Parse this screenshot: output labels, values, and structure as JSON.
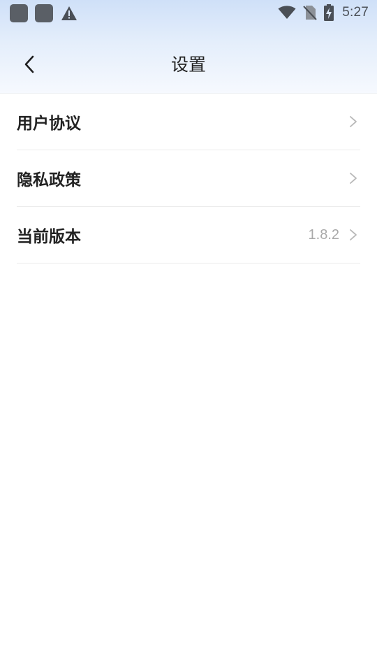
{
  "status_bar": {
    "time": "5:27",
    "icons": [
      "app-notification-icon",
      "app-notification-icon",
      "warning-icon",
      "wifi-icon",
      "no-sim-icon",
      "battery-charging-icon"
    ]
  },
  "header": {
    "title": "设置",
    "back_icon": "chevron-left-icon"
  },
  "settings": {
    "items": [
      {
        "label": "用户协议",
        "value": ""
      },
      {
        "label": "隐私政策",
        "value": ""
      },
      {
        "label": "当前版本",
        "value": "1.8.2"
      }
    ]
  },
  "colors": {
    "header_gradient_top": "#cfe0f8",
    "header_gradient_bottom": "#f6f9fe",
    "label": "#222222",
    "secondary": "#a9a9a9",
    "divider": "#ececec"
  }
}
